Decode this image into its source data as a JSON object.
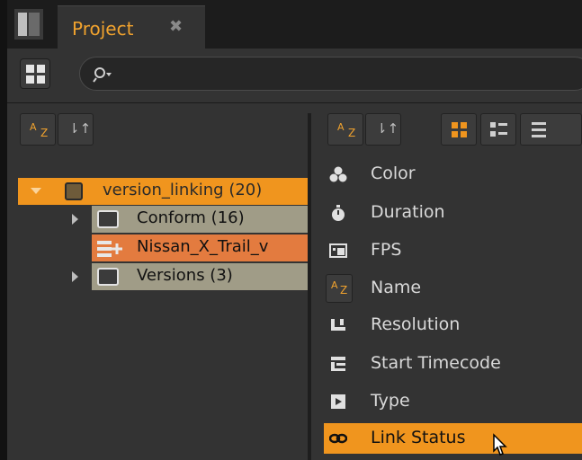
{
  "window": {
    "tab_title": "Project",
    "tab_close_glyph": "✖"
  },
  "toolbar": {
    "grid_icon": "grid-icon",
    "search_icon": "search-icon"
  },
  "left_pane": {
    "sort_az": {
      "a": "A",
      "z": "Z"
    },
    "sort_order_glyph": "⇂↑",
    "tree": {
      "root": {
        "label": "version_linking (20)"
      },
      "children": [
        {
          "label": "Conform (16)",
          "type": "folder"
        },
        {
          "label": "Nissan_X_Trail_v",
          "type": "clip"
        },
        {
          "label": "Versions (3)",
          "type": "folder"
        }
      ]
    }
  },
  "right_pane": {
    "sort_az": {
      "a": "A",
      "z": "Z"
    },
    "sort_order_glyph": "⇂↑",
    "view_icons": [
      "thumbnail-grid-icon",
      "detail-grid-icon",
      "list-view-icon"
    ],
    "menu": [
      {
        "label": "Color",
        "icon": "color-icon"
      },
      {
        "label": "Duration",
        "icon": "stopwatch-icon"
      },
      {
        "label": "FPS",
        "icon": "fps-icon"
      },
      {
        "label": "Name",
        "icon": "az-icon"
      },
      {
        "label": "Resolution",
        "icon": "resolution-icon"
      },
      {
        "label": "Start Timecode",
        "icon": "timecode-icon"
      },
      {
        "label": "Type",
        "icon": "type-icon"
      },
      {
        "label": "Link Status",
        "icon": "link-icon",
        "highlighted": true
      }
    ]
  },
  "colors": {
    "accent": "#f0951e",
    "tab_text": "#f0a22e",
    "selected_row": "#e37b3f",
    "child_row": "#a09c87"
  }
}
